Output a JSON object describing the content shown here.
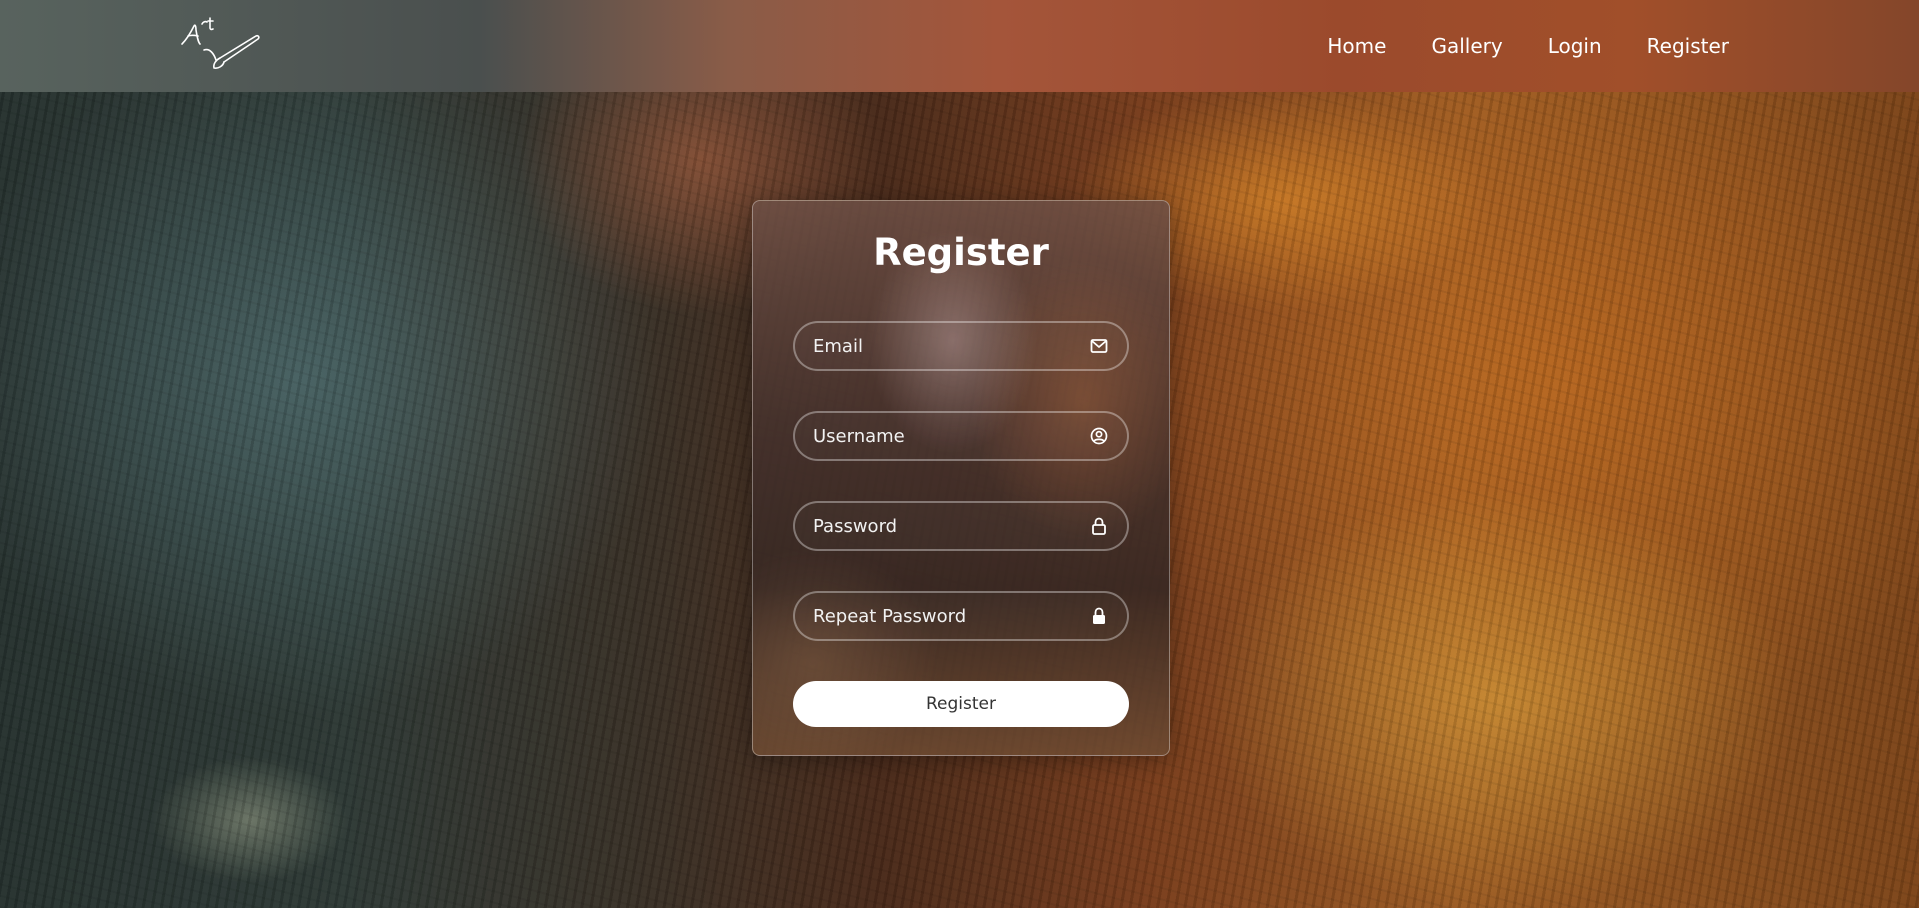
{
  "nav": {
    "links": [
      "Home",
      "Gallery",
      "Login",
      "Register"
    ]
  },
  "form": {
    "title": "Register",
    "email_placeholder": "Email",
    "username_placeholder": "Username",
    "password_placeholder": "Password",
    "repeat_password_placeholder": "Repeat Password",
    "submit_label": "Register"
  },
  "icons": {
    "logo": "art-brush-logo",
    "email": "envelope-icon",
    "username": "user-circle-icon",
    "password": "lock-outline-icon",
    "repeat_password": "lock-solid-icon"
  },
  "colors": {
    "button_bg": "#ffffff",
    "button_text": "#333333",
    "text": "#ffffff"
  }
}
